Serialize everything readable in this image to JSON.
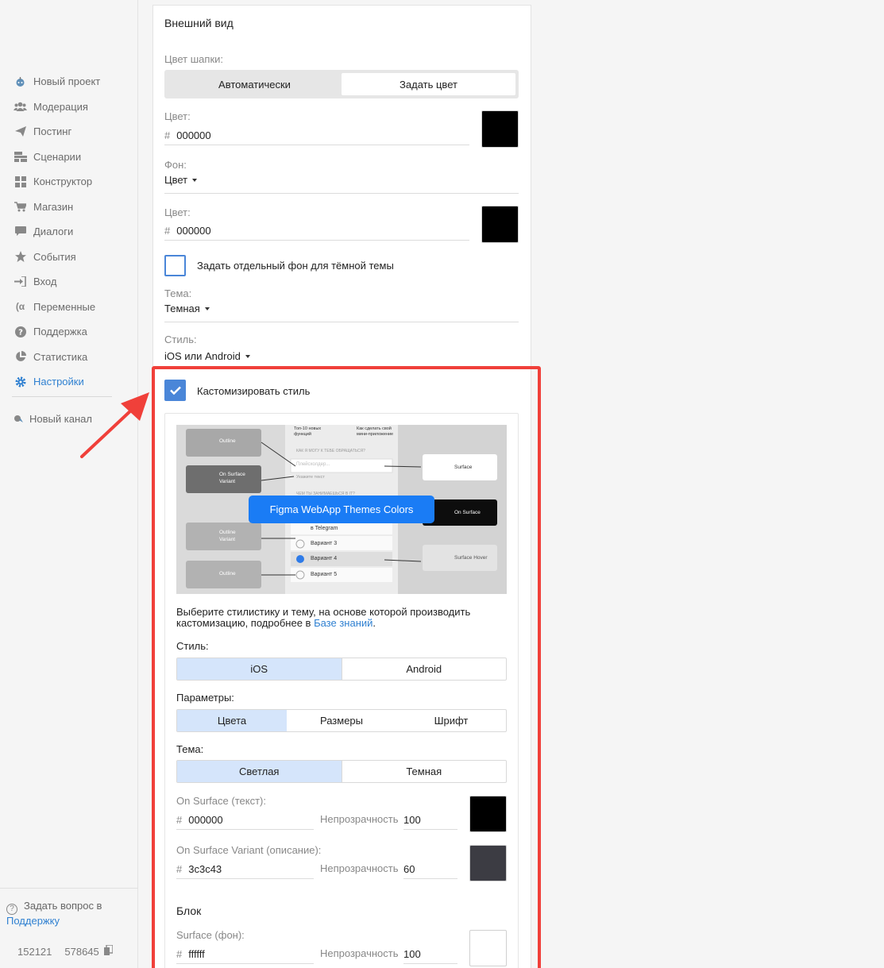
{
  "sidebar": {
    "items": [
      {
        "label": "Новый проект",
        "icon": "robot-icon"
      },
      {
        "label": "Модерация",
        "icon": "users-icon"
      },
      {
        "label": "Постинг",
        "icon": "paper-plane-icon"
      },
      {
        "label": "Сценарии",
        "icon": "scenarios-icon"
      },
      {
        "label": "Конструктор",
        "icon": "grid-icon"
      },
      {
        "label": "Магазин",
        "icon": "cart-icon"
      },
      {
        "label": "Диалоги",
        "icon": "chat-icon"
      },
      {
        "label": "События",
        "icon": "star-icon"
      },
      {
        "label": "Вход",
        "icon": "sign-in-icon"
      },
      {
        "label": "Переменные",
        "icon": "variable-icon"
      },
      {
        "label": "Поддержка",
        "icon": "question-icon"
      },
      {
        "label": "Статистика",
        "icon": "pie-chart-icon"
      },
      {
        "label": "Настройки",
        "icon": "gear-icon",
        "active": true
      }
    ],
    "new_channel": "Новый канал",
    "help_prefix": "Задать вопрос в",
    "help_link": "Поддержку",
    "id1": "152121",
    "id2": "578645"
  },
  "appearance": {
    "title": "Внешний вид",
    "header_color_label": "Цвет шапки:",
    "header_auto": "Автоматически",
    "header_set": "Задать цвет",
    "color_label": "Цвет:",
    "hash": "#",
    "color_value": "000000",
    "bg_label": "Фон:",
    "bg_value": "Цвет",
    "color2_label": "Цвет:",
    "color2_value": "000000",
    "dark_bg_checkbox": "Задать отдельный фон для тёмной темы",
    "theme_label": "Тема:",
    "theme_value": "Темная",
    "style_label": "Стиль:",
    "style_value": "iOS или Android",
    "customize_checkbox": "Кастомизировать стиль"
  },
  "preview": {
    "banner": "Figma WebApp Themes Colors",
    "chip_outline": "Outline",
    "chip_on_surface_variant": "On Surface Variant",
    "chip_outline_variant": "Outline Variant",
    "chip_outline2": "Outline",
    "chip_surface": "Surface",
    "chip_on_surface": "On Surface",
    "chip_surface_hover": "Surface Hover",
    "top_left": "Топ-10 новых функций",
    "top_right": "Как сделать свой мини-приложение",
    "q1": "КАК Я МОГУ К ТЕБЕ ОБРАЩАТЬСЯ?",
    "placeholder": "Плейсхолдер...",
    "hint": "Укажите текст",
    "q2": "ЧЕМ ТЫ ЗАНИМАЕШЬСЯ В IT?",
    "opt1": "в Telegram",
    "opt2": "Вариант 3",
    "opt3": "Вариант 4",
    "opt4": "Вариант 5"
  },
  "custom": {
    "desc": "Выберите стилистику и тему, на основе которой производить кастомизацию, подробнее в ",
    "desc_link": "Базе знаний",
    "desc_end": ".",
    "style_label": "Стиль:",
    "style_ios": "iOS",
    "style_android": "Android",
    "params_label": "Параметры:",
    "params_colors": "Цвета",
    "params_sizes": "Размеры",
    "params_font": "Шрифт",
    "theme_label": "Тема:",
    "theme_light": "Светлая",
    "theme_dark": "Темная",
    "on_surface_label": "On Surface (текст):",
    "on_surface_value": "000000",
    "opacity_label": "Непрозрачность",
    "on_surface_opacity": "100",
    "on_surface_variant_label": "On Surface Variant (описание):",
    "on_surface_variant_value": "3c3c43",
    "on_surface_variant_opacity": "60",
    "block_title": "Блок",
    "surface_label": "Surface (фон):",
    "surface_value": "ffffff",
    "surface_opacity": "100"
  },
  "colors": {
    "accent": "#2f80d1",
    "highlight": "#f0403a",
    "swatch_black": "#000000",
    "swatch_3c3c43": "#3c3c43",
    "swatch_white": "#ffffff"
  }
}
